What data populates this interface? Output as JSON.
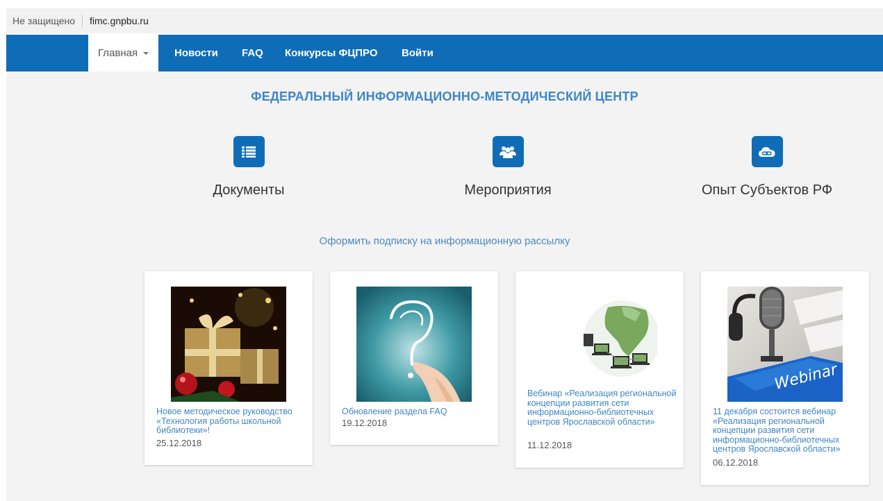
{
  "browser": {
    "security_label": "Не защищено",
    "url": "fimc.gnpbu.ru"
  },
  "nav": {
    "home": "Главная",
    "news": "Новости",
    "faq": "FAQ",
    "contests": "Конкурсы ФЦПРО",
    "login": "Войти"
  },
  "header": {
    "title": "ФЕДЕРАЛЬНЫЙ ИНФОРМАЦИОННО-МЕТОДИЧЕСКИЙ ЦЕНТР"
  },
  "features": [
    {
      "label": "Документы",
      "icon": "list-icon"
    },
    {
      "label": "Мероприятия",
      "icon": "users-icon"
    },
    {
      "label": "Опыт Субъектов РФ",
      "icon": "cloud-link-icon"
    }
  ],
  "subscribe": {
    "label": "Оформить подписку на информационную рассылку"
  },
  "news": [
    {
      "title": "Новое методическое руководство «Технология работы школьной библиотеки»!",
      "date": "25.12.2018",
      "image": "christmas-gifts-image"
    },
    {
      "title": "Обновление раздела FAQ",
      "date": "19.12.2018",
      "image": "question-mark-image"
    },
    {
      "title": "Вебинар «Реализация региональной концепции развития сети информационно-библиотечных центров Ярославской области»",
      "date": "11.12.2018",
      "image": "network-globe-image"
    },
    {
      "title": "11 декабря состоится вебинар «Реализация региональной концепции развития сети информационно-библиотечных центров Ярославской области»",
      "date": "06.12.2018",
      "image": "webinar-microphone-image"
    }
  ],
  "image_text": {
    "webinar_key": "Webinar"
  },
  "colors": {
    "nav_bg": "#0f6db8",
    "accent": "#3f86c6",
    "page_bg": "#f3f3f3"
  }
}
